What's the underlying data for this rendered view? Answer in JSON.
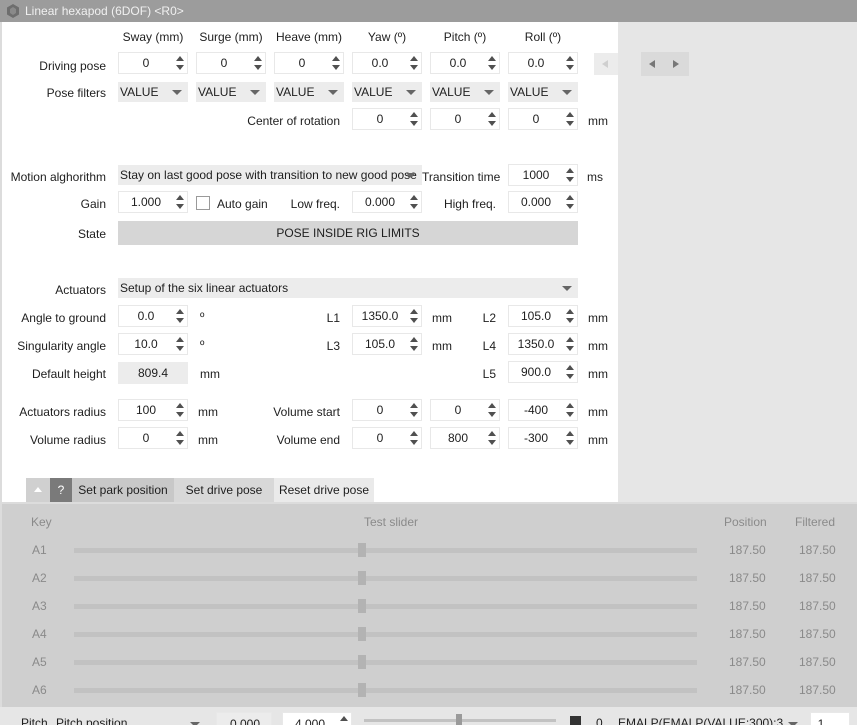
{
  "window": {
    "title": "Linear hexapod (6DOF) <R0>"
  },
  "pose": {
    "columns": [
      "Sway (mm)",
      "Surge (mm)",
      "Heave (mm)",
      "Yaw (º)",
      "Pitch (º)",
      "Roll (º)"
    ],
    "driving_label": "Driving pose",
    "driving_values": [
      "0",
      "0",
      "0",
      "0.0",
      "0.0",
      "0.0"
    ],
    "filters_label": "Pose filters",
    "filter_values": [
      "VALUE",
      "VALUE",
      "VALUE",
      "VALUE",
      "VALUE",
      "VALUE"
    ],
    "cor_label": "Center of rotation",
    "cor_values": [
      "0",
      "0",
      "0"
    ],
    "cor_unit": "mm"
  },
  "motion": {
    "label": "Motion alghorithm",
    "value": "Stay on last good pose with transition to new good pose",
    "transition_label": "Transition time",
    "transition_value": "1000",
    "transition_unit": "ms",
    "gain_label": "Gain",
    "gain_value": "1.000",
    "autogain_label": "Auto gain",
    "lowfreq_label": "Low freq.",
    "lowfreq_value": "0.000",
    "highfreq_label": "High freq.",
    "highfreq_value": "0.000",
    "state_label": "State",
    "state_value": "POSE INSIDE RIG LIMITS"
  },
  "actuators": {
    "label": "Actuators",
    "value": "Setup of the six linear actuators",
    "angle_ground_label": "Angle to ground",
    "angle_ground_value": "0.0",
    "angle_unit": "º",
    "singularity_label": "Singularity angle",
    "singularity_value": "10.0",
    "default_height_label": "Default height",
    "default_height_value": "809.4",
    "mm": "mm",
    "l1_label": "L1",
    "l1_value": "1350.0",
    "l2_label": "L2",
    "l2_value": "105.0",
    "l3_label": "L3",
    "l3_value": "105.0",
    "l4_label": "L4",
    "l4_value": "1350.0",
    "l5_label": "L5",
    "l5_value": "900.0",
    "act_radius_label": "Actuators radius",
    "act_radius_value": "100",
    "vol_radius_label": "Volume radius",
    "vol_radius_value": "0",
    "vol_start_label": "Volume start",
    "vol_start_values": [
      "0",
      "0",
      "-400"
    ],
    "vol_end_label": "Volume end",
    "vol_end_values": [
      "0",
      "800",
      "-300"
    ]
  },
  "tabs": {
    "help": "?",
    "park": "Set park position",
    "drive": "Set drive pose",
    "reset": "Reset drive pose"
  },
  "slider_table": {
    "headers": {
      "key": "Key",
      "test": "Test slider",
      "position": "Position",
      "filtered": "Filtered"
    },
    "rows": [
      {
        "key": "A1",
        "position": "187.50",
        "filtered": "187.50",
        "fraction": 0.4615
      },
      {
        "key": "A2",
        "position": "187.50",
        "filtered": "187.50",
        "fraction": 0.4615
      },
      {
        "key": "A3",
        "position": "187.50",
        "filtered": "187.50",
        "fraction": 0.4615
      },
      {
        "key": "A4",
        "position": "187.50",
        "filtered": "187.50",
        "fraction": 0.4615
      },
      {
        "key": "A5",
        "position": "187.50",
        "filtered": "187.50",
        "fraction": 0.4615
      },
      {
        "key": "A6",
        "position": "187.50",
        "filtered": "187.50",
        "fraction": 0.4615
      }
    ]
  },
  "status_strip": {
    "label": "Pitch",
    "combo": "Pitch position",
    "value1": "0.000",
    "value2": "4.000",
    "value3": "0",
    "formula": "EMALP(EMALP(VALUE;300);3",
    "value4": "1"
  }
}
